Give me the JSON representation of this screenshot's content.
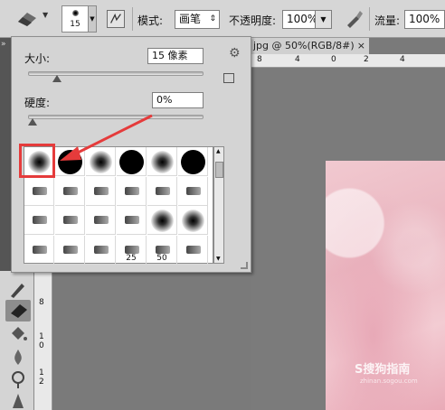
{
  "options_bar": {
    "brush_size": "15",
    "mode_label": "模式:",
    "mode_value": "画笔",
    "opacity_label": "不透明度:",
    "opacity_value": "100%",
    "flow_label": "流量:",
    "flow_value": "100%"
  },
  "document": {
    "tab_title": "jpg @ 50%(RGB/8#)",
    "close_glyph": "×",
    "ruler_h": [
      "8",
      "4",
      "0",
      "2",
      "4"
    ],
    "ruler_v": [
      "8",
      "1 0",
      "1 2"
    ]
  },
  "brush_panel": {
    "size_label": "大小:",
    "size_value": "15 像素",
    "size_fraction": 0.05,
    "hardness_label": "硬度:",
    "hardness_value": "0%",
    "hardness_fraction": 0.0,
    "presets": [
      {
        "kind": "soft",
        "label": ""
      },
      {
        "kind": "hard",
        "label": ""
      },
      {
        "kind": "soft",
        "label": ""
      },
      {
        "kind": "hard",
        "label": ""
      },
      {
        "kind": "soft",
        "label": ""
      },
      {
        "kind": "hard",
        "label": ""
      },
      {
        "kind": "tip",
        "label": ""
      },
      {
        "kind": "tip",
        "label": ""
      },
      {
        "kind": "tip",
        "label": ""
      },
      {
        "kind": "tip",
        "label": ""
      },
      {
        "kind": "tip",
        "label": ""
      },
      {
        "kind": "tip",
        "label": ""
      },
      {
        "kind": "tip",
        "label": ""
      },
      {
        "kind": "tip",
        "label": ""
      },
      {
        "kind": "tip",
        "label": ""
      },
      {
        "kind": "tip",
        "label": ""
      },
      {
        "kind": "soft",
        "label": ""
      },
      {
        "kind": "soft",
        "label": ""
      },
      {
        "kind": "tip",
        "label": ""
      },
      {
        "kind": "tip",
        "label": ""
      },
      {
        "kind": "tip",
        "label": ""
      },
      {
        "kind": "tip",
        "label": "25"
      },
      {
        "kind": "tip",
        "label": "50"
      },
      {
        "kind": "tip",
        "label": ""
      }
    ]
  },
  "watermark": {
    "main": "S搜狗指南",
    "sub": "zhinan.sogou.com"
  },
  "colors": {
    "highlight": "#e53b3b",
    "panel_bg": "#d4d4d4"
  }
}
